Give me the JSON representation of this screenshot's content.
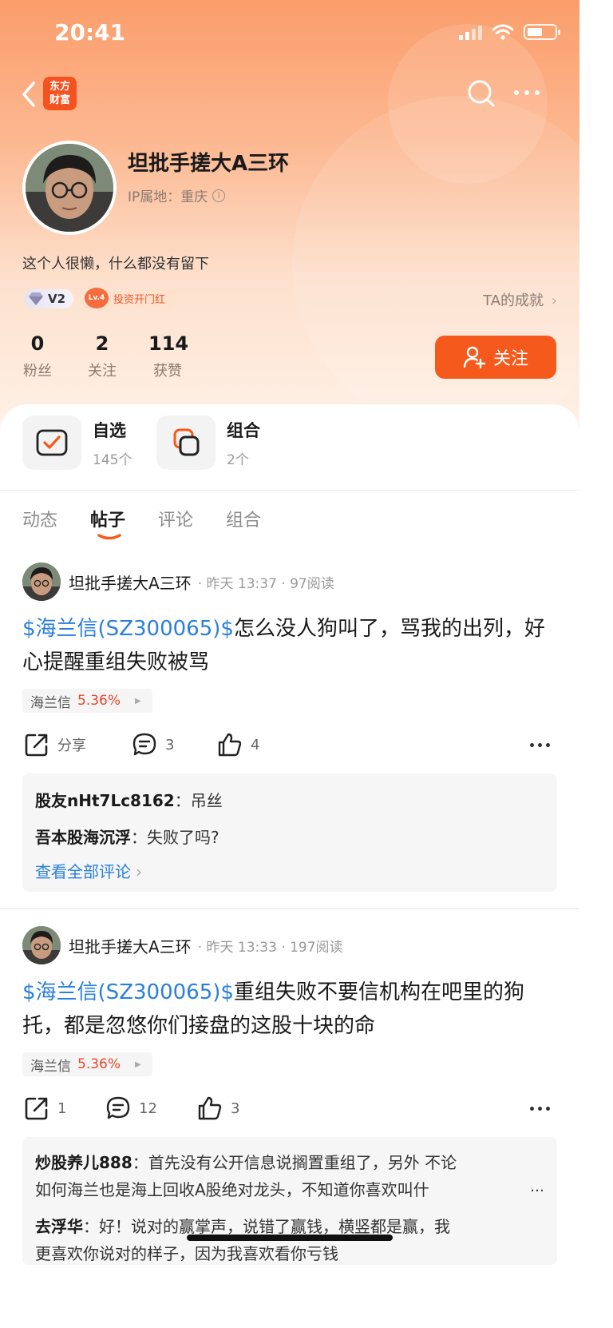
{
  "status_bar": {
    "time": "20:41"
  },
  "header": {
    "logo_text": "东方财富"
  },
  "profile": {
    "username": "坦批手搓大A三环",
    "ip_location": "IP属地：重庆",
    "bio": "这个人很懒，什么都没有留下",
    "badge_v2": "V2",
    "badge_level": "Lv.4",
    "badge_title": "投资开门红",
    "achievement_link": "TA的成就",
    "stats": [
      {
        "value": "0",
        "label": "粉丝"
      },
      {
        "value": "2",
        "label": "关注"
      },
      {
        "value": "114",
        "label": "获赞"
      }
    ],
    "follow_label": "关注"
  },
  "quick_links": [
    {
      "name": "自选",
      "count": "145个"
    },
    {
      "name": "组合",
      "count": "2个"
    }
  ],
  "tabs": [
    {
      "label": "动态",
      "active": false
    },
    {
      "label": "帖子",
      "active": true
    },
    {
      "label": "评论",
      "active": false
    },
    {
      "label": "组合",
      "active": false
    }
  ],
  "posts": [
    {
      "author": "坦批手搓大A三环",
      "time": "· 昨天 13:37 · 97阅读",
      "tag": "$海兰信(SZ300065)$",
      "text": "怎么没人狗叫了，骂我的出列，好心提醒重组失败被骂",
      "stock_name": "海兰信",
      "stock_change": "5.36%",
      "share_label": "分享",
      "comment_count": "3",
      "like_count": "4",
      "comments": [
        {
          "who": "股友nHt7Lc8162",
          "text": "：吊丝"
        },
        {
          "who": "吾本股海沉浮",
          "text": "：失败了吗?"
        }
      ],
      "view_all": "查看全部评论"
    },
    {
      "author": "坦批手搓大A三环",
      "time": "· 昨天 13:33 · 197阅读",
      "tag": "$海兰信(SZ300065)$",
      "text": "重组失败不要信机构在吧里的狗托，都是忽悠你们接盘的这股十块的命",
      "stock_name": "海兰信",
      "stock_change": "5.36%",
      "share_count": "1",
      "comment_count": "12",
      "like_count": "3",
      "comments": [
        {
          "who": "炒股养儿888",
          "text": "：首先没有公开信息说搁置重组了，另外 不论",
          "text2": "如何海兰也是海上回收A股绝对龙头，不知道你喜欢叫什"
        },
        {
          "who": "去浮华",
          "text": "：好！说对的赢掌声，说错了赢钱，横竖都是赢，我",
          "text2": "更喜欢你说对的样子，因为我喜欢看你亏钱"
        }
      ]
    }
  ],
  "colors": {
    "accent": "#f55a1c",
    "link": "#2a7fdb",
    "up": "#e8452b"
  }
}
